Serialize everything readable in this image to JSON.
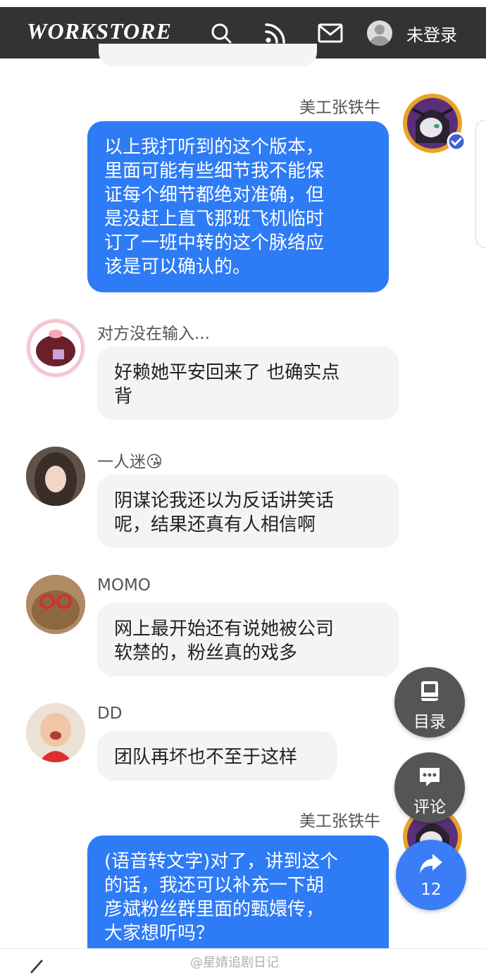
{
  "header": {
    "logo": "WORKSTORE",
    "search_icon": "search-icon",
    "rss_icon": "rss-icon",
    "mail_icon": "mail-icon",
    "login_label": "未登录"
  },
  "messages": [
    {
      "sender": "美工张铁牛",
      "side": "right",
      "text": "以上我打听到的这个版本，里面可能有些细节我不能保证每个细节都绝对准确，但是没赶上直飞那班飞机临时订了一班中转的这个脉络应该是可以确认的。",
      "lines": [
        "以上我打听到的这个版本，",
        "里面可能有些细节我不能保",
        "证每个细节都绝对准确，但",
        "是没赶上直飞那班飞机临时",
        "订了一班中转的这个脉络应",
        "该是可以确认的。"
      ]
    },
    {
      "sender": "对方没在输入...",
      "side": "left",
      "lines": [
        "好赖她平安回来了 也确实点",
        "背"
      ]
    },
    {
      "sender": "一人迷😘",
      "side": "left",
      "lines": [
        "阴谋论我还以为反话讲笑话",
        "呢，结果还真有人相信啊"
      ]
    },
    {
      "sender": "MOMO",
      "side": "left",
      "lines": [
        "网上最开始还有说她被公司",
        "软禁的，粉丝真的戏多"
      ]
    },
    {
      "sender": "DD",
      "side": "left",
      "lines": [
        "团队再坏也不至于这样"
      ]
    },
    {
      "sender": "美工张铁牛",
      "side": "right",
      "lines": [
        "(语音转文字)对了，讲到这个",
        "的话，我还可以补充一下胡",
        "彦斌粉丝群里面的甄嬛传，",
        "大家想听吗？"
      ]
    }
  ],
  "fabs": {
    "toc_label": "目录",
    "comment_label": "评论",
    "share_count": "12"
  },
  "watermark": "@星婧追剧日记",
  "colors": {
    "header_bg": "#333333",
    "my_bubble": "#2e7bf6",
    "other_bubble": "#f4f4f5",
    "fab_dark": "#555555",
    "fab_blue": "#3a7df6"
  }
}
